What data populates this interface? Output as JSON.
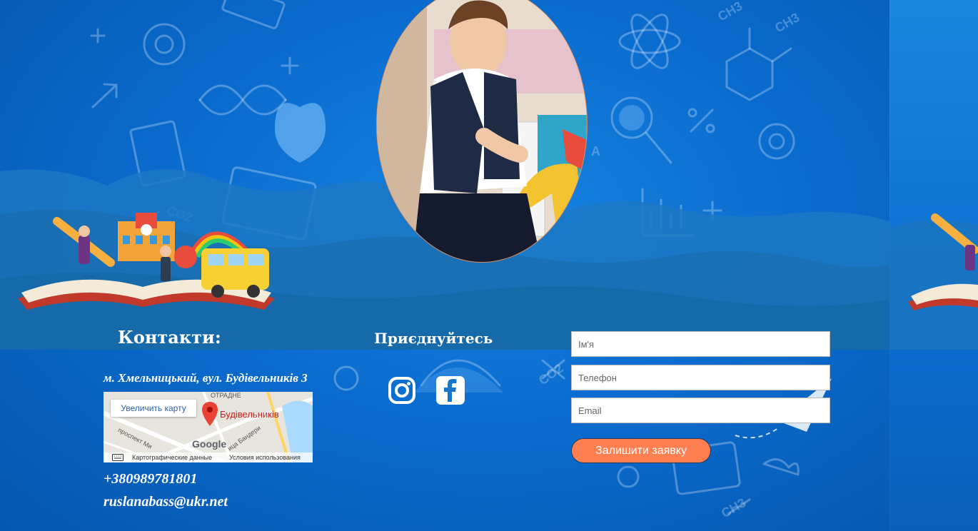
{
  "contacts": {
    "title": "Контакти:",
    "address": "м. Хмельницький, вул. Будівельників 3",
    "phone": "+380989781801",
    "email": "ruslanabass@ukr.net"
  },
  "map": {
    "enlarge_label": "Увеличить карту",
    "place_label": "Будівельників",
    "google_label": "Google",
    "map_data_label": "Картографические данные",
    "terms_label": "Условия использования",
    "street_1": "проспект Ми",
    "street_2": "ица Бандери",
    "district": "ОТРАДНЕ"
  },
  "social": {
    "title": "Приєднуйтесь",
    "icons": [
      "instagram-icon",
      "facebook-icon"
    ]
  },
  "form": {
    "name_placeholder": "Ім'я",
    "phone_placeholder": "Телефон",
    "email_placeholder": "Email",
    "submit_label": "Залишити заявку"
  },
  "colors": {
    "background": "#0a66c7",
    "accent_button": "#ff7f50",
    "map_pin": "#ea4335"
  }
}
